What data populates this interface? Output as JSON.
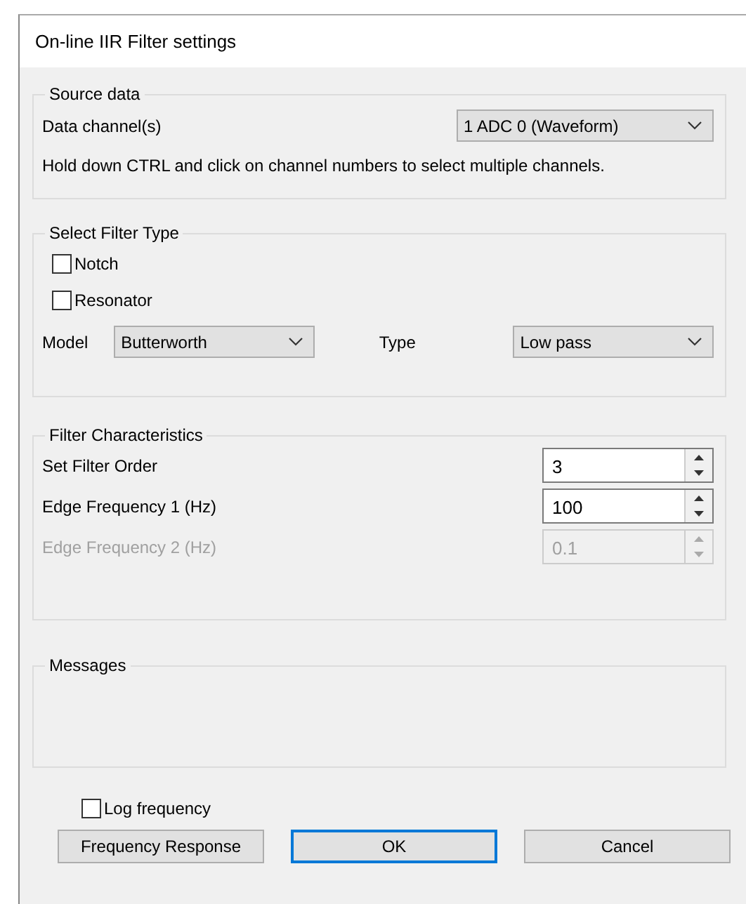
{
  "window": {
    "title": "On-line IIR Filter settings"
  },
  "source_data": {
    "title": "Source data",
    "channel_label": "Data channel(s)",
    "channel_value": "1 ADC 0 (Waveform)",
    "hint": "Hold down CTRL and click on channel numbers to select multiple channels."
  },
  "filter_type": {
    "title": "Select Filter Type",
    "options": [
      {
        "label": "Notch",
        "checked": false
      },
      {
        "label": "Resonator",
        "checked": false
      }
    ],
    "model_label": "Model",
    "model_value": "Butterworth",
    "type_label": "Type",
    "type_value": "Low pass"
  },
  "characteristics": {
    "title": "Filter Characteristics",
    "rows": [
      {
        "label": "Set Filter Order",
        "value": "3",
        "disabled": false
      },
      {
        "label": "Edge Frequency 1 (Hz)",
        "value": "100",
        "disabled": false
      },
      {
        "label": "Edge Frequency 2 (Hz)",
        "value": "0.1",
        "disabled": true
      }
    ]
  },
  "messages": {
    "title": "Messages"
  },
  "log_frequency": {
    "label": "Log frequency",
    "checked": false
  },
  "buttons": [
    {
      "label": "Frequency Response",
      "default": false
    },
    {
      "label": "OK",
      "default": true
    },
    {
      "label": "Cancel",
      "default": false
    }
  ]
}
